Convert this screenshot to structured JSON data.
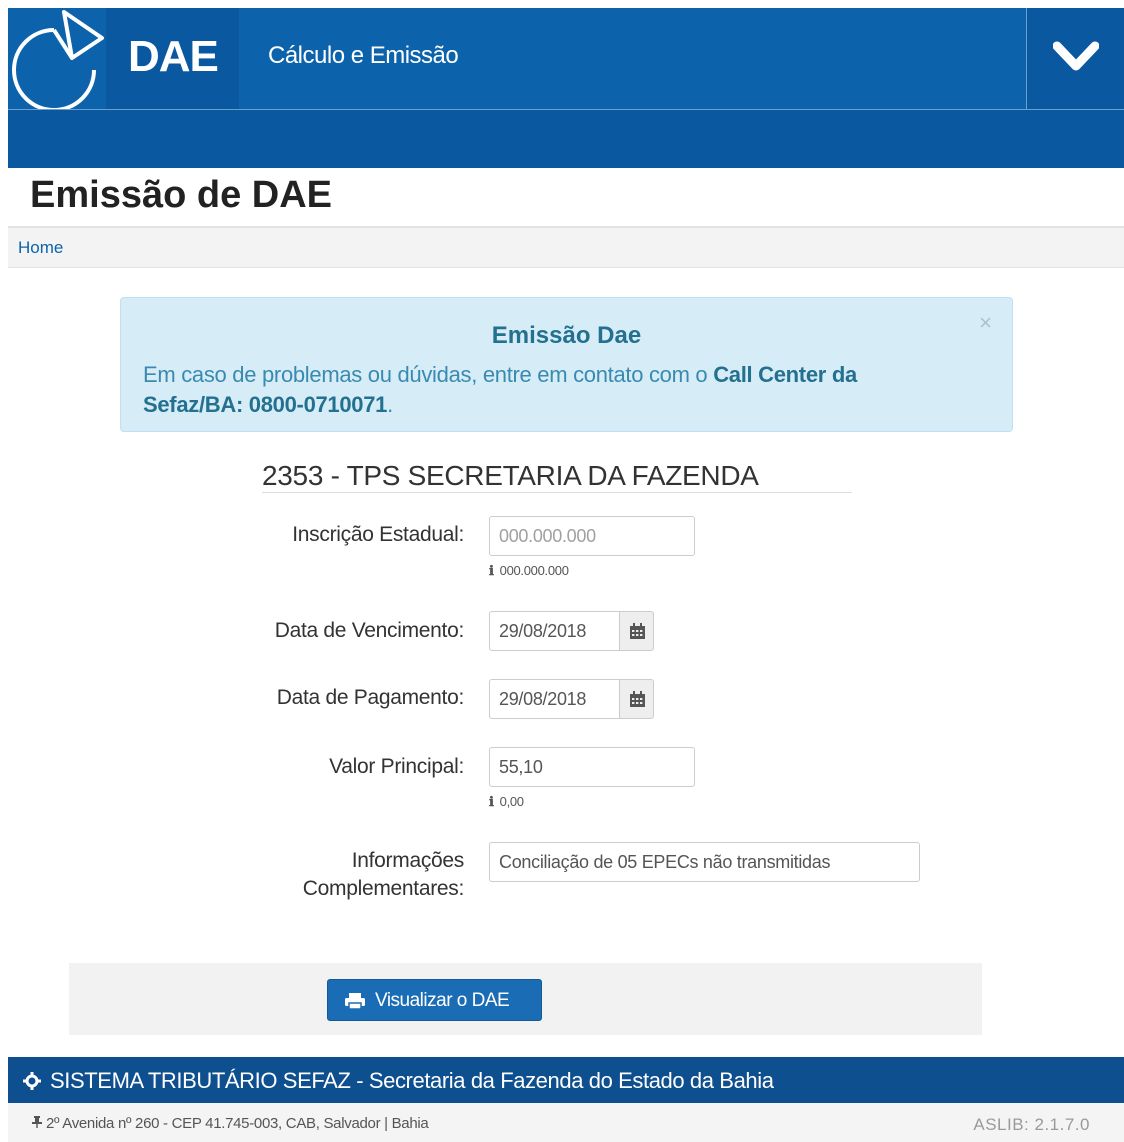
{
  "header": {
    "app_name": "DAE",
    "subtitle": "Cálculo e Emissão",
    "toggle_icon": "chevron-down-icon"
  },
  "page": {
    "title": "Emissão de DAE"
  },
  "breadcrumb": {
    "home": "Home"
  },
  "alert": {
    "close": "×",
    "title": "Emissão Dae",
    "text": "Em caso de problemas ou dúvidas, entre em contato com o ",
    "highlight": "Call Center da Sefaz/BA: 0800-0710071",
    "end": "."
  },
  "form": {
    "heading": "2353 - TPS SECRETARIA DA FAZENDA",
    "inscricao": {
      "label": "Inscrição Estadual:",
      "placeholder": "000.000.000",
      "value": "",
      "help": "000.000.000"
    },
    "vencimento": {
      "label": "Data de Vencimento:",
      "value": "29/08/2018"
    },
    "pagamento": {
      "label": "Data de Pagamento:",
      "value": "29/08/2018"
    },
    "valor": {
      "label": "Valor Principal:",
      "value": "55,10",
      "help": "0,00"
    },
    "informacoes": {
      "label_line1": "Informações",
      "label_line2": "Complementares:",
      "value": "Conciliação de 05 EPECs não transmitidas"
    },
    "info_icon": "ℹ"
  },
  "actions": {
    "visualizar": "Visualizar o DAE"
  },
  "footer": {
    "system": "SISTEMA TRIBUTÁRIO SEFAZ - Secretaria da Fazenda do Estado da Bahia",
    "address": "2º Avenida nº 260 - CEP 41.745-003, CAB, Salvador | Bahia",
    "version": "ASLIB: 2.1.7.0"
  },
  "colors": {
    "brand_blue": "#0d63ab",
    "alert_bg": "#d6edf8",
    "button_blue": "#1a6db5"
  }
}
